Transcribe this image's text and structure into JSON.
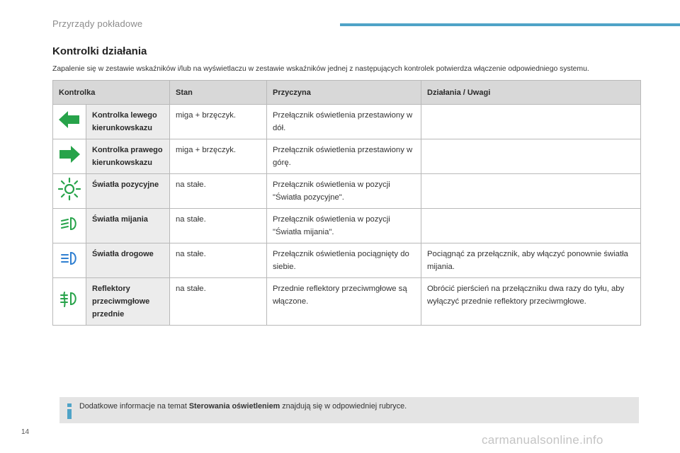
{
  "header": {
    "section_title": "Przyrządy pokładowe",
    "accent_color": "#4fa3c7"
  },
  "heading": "Kontrolki działania",
  "intro": "Zapalenie się w zestawie wskaźników i/lub na wyświetlaczu w zestawie wskaźników jednej z następujących kontrolek potwierdza włączenie odpowiedniego systemu.",
  "table": {
    "columns": [
      "Kontrolka",
      "Stan",
      "Przyczyna",
      "Działania / Uwagi"
    ],
    "rows": [
      {
        "icon": "left-turn-arrow-icon",
        "color": "#27a34a",
        "name": "Kontrolka lewego kierunkowskazu",
        "state": "miga + brzęczyk.",
        "cause": "Przełącznik oświetlenia przestawiony w dół.",
        "action": ""
      },
      {
        "icon": "right-turn-arrow-icon",
        "color": "#27a34a",
        "name": "Kontrolka prawego kierunkowskazu",
        "state": "miga + brzęczyk.",
        "cause": "Przełącznik oświetlenia przestawiony w górę.",
        "action": ""
      },
      {
        "icon": "position-lights-icon",
        "color": "#27a34a",
        "name": "Światła pozycyjne",
        "state": "na stałe.",
        "cause": "Przełącznik oświetlenia w pozycji \"Światła pozycyjne\".",
        "action": ""
      },
      {
        "icon": "dipped-beam-icon",
        "color": "#27a34a",
        "name": "Światła mijania",
        "state": "na stałe.",
        "cause": "Przełącznik oświetlenia w pozycji \"Światła mijania\".",
        "action": ""
      },
      {
        "icon": "main-beam-icon",
        "color": "#2f7fd1",
        "name": "Światła drogowe",
        "state": "na stałe.",
        "cause": "Przełącznik oświetlenia pociągnięty do siebie.",
        "action": "Pociągnąć za przełącznik, aby włączyć ponownie światła mijania."
      },
      {
        "icon": "front-fog-lamps-icon",
        "color": "#27a34a",
        "name": "Reflektory przeciwmgłowe przednie",
        "state": "na stałe.",
        "cause": "Przednie reflektory przeciwmgłowe są włączone.",
        "action": "Obrócić pierścień na przełączniku dwa razy do tyłu, aby wyłączyć przednie reflektory przeciwmgłowe."
      }
    ]
  },
  "info": {
    "icon": "info-icon",
    "text_before": "Dodatkowe informacje na temat ",
    "text_bold": "Sterowania oświetleniem",
    "text_after": " znajdują się w odpowiedniej rubryce."
  },
  "page_number": "14",
  "watermark": "carmanualsonline.info"
}
